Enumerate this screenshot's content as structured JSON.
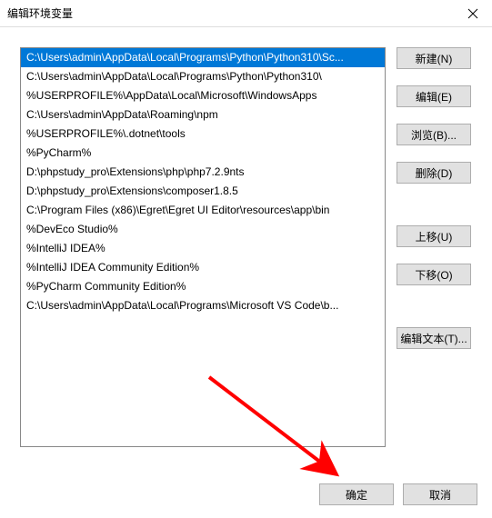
{
  "dialog": {
    "title": "编辑环境变量",
    "close_icon": "close-icon"
  },
  "list": {
    "items": [
      "C:\\Users\\admin\\AppData\\Local\\Programs\\Python\\Python310\\Sc...",
      "C:\\Users\\admin\\AppData\\Local\\Programs\\Python\\Python310\\",
      "%USERPROFILE%\\AppData\\Local\\Microsoft\\WindowsApps",
      "C:\\Users\\admin\\AppData\\Roaming\\npm",
      "%USERPROFILE%\\.dotnet\\tools",
      "%PyCharm%",
      "D:\\phpstudy_pro\\Extensions\\php\\php7.2.9nts",
      "D:\\phpstudy_pro\\Extensions\\composer1.8.5",
      "C:\\Program Files (x86)\\Egret\\Egret UI Editor\\resources\\app\\bin",
      "%DevEco Studio%",
      "%IntelliJ IDEA%",
      "%IntelliJ IDEA Community Edition%",
      "%PyCharm Community Edition%",
      "C:\\Users\\admin\\AppData\\Local\\Programs\\Microsoft VS Code\\b..."
    ],
    "selected_index": 0
  },
  "buttons": {
    "new": "新建(N)",
    "edit": "编辑(E)",
    "browse": "浏览(B)...",
    "delete": "删除(D)",
    "move_up": "上移(U)",
    "move_down": "下移(O)",
    "edit_text": "编辑文本(T)...",
    "ok": "确定",
    "cancel": "取消"
  },
  "annotation": {
    "arrow_color": "#ff0000"
  }
}
